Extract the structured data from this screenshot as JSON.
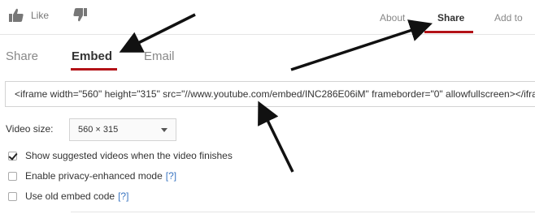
{
  "topbar": {
    "like_label": "Like",
    "tabs": [
      {
        "label": "About",
        "active": false
      },
      {
        "label": "Share",
        "active": true
      },
      {
        "label": "Add to",
        "active": false
      }
    ]
  },
  "share_tabs": [
    {
      "label": "Share",
      "active": false
    },
    {
      "label": "Embed",
      "active": true
    },
    {
      "label": "Email",
      "active": false
    }
  ],
  "embed": {
    "code": "<iframe width=\"560\" height=\"315\" src=\"//www.youtube.com/embed/INC286E06iM\" frameborder=\"0\" allowfullscreen></iframe>"
  },
  "video_size": {
    "label": "Video size:",
    "selected": "560 × 315"
  },
  "options": [
    {
      "label": "Show suggested videos when the video finishes",
      "checked": true,
      "help": ""
    },
    {
      "label": "Enable privacy-enhanced mode",
      "checked": false,
      "help": "[?]"
    },
    {
      "label": "Use old embed code",
      "checked": false,
      "help": "[?]"
    }
  ],
  "colors": {
    "accent": "#b31217",
    "link": "#3b76c2",
    "icon": "#777777"
  },
  "icons": {
    "like": "thumbs-up-icon",
    "dislike": "thumbs-down-icon",
    "dropdown": "chevron-down-icon"
  }
}
